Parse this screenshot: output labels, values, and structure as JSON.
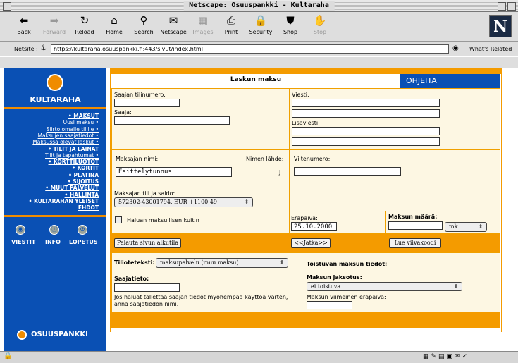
{
  "window": {
    "title": "Netscape: Osuuspankki - Kultaraha"
  },
  "toolbar": {
    "buttons": [
      {
        "label": "Back",
        "icon": "back-arrow-icon",
        "glyph": "⬅",
        "enabled": true
      },
      {
        "label": "Forward",
        "icon": "forward-arrow-icon",
        "glyph": "➡",
        "enabled": false
      },
      {
        "label": "Reload",
        "icon": "reload-icon",
        "glyph": "↻",
        "enabled": true
      },
      {
        "label": "Home",
        "icon": "home-icon",
        "glyph": "⌂",
        "enabled": true
      },
      {
        "label": "Search",
        "icon": "search-icon",
        "glyph": "⚲",
        "enabled": true
      },
      {
        "label": "Netscape",
        "icon": "netscape-icon",
        "glyph": "✉",
        "enabled": true
      },
      {
        "label": "Images",
        "icon": "images-icon",
        "glyph": "▦",
        "enabled": false
      },
      {
        "label": "Print",
        "icon": "print-icon",
        "glyph": "⎙",
        "enabled": true
      },
      {
        "label": "Security",
        "icon": "lock-icon",
        "glyph": "🔒",
        "enabled": true
      },
      {
        "label": "Shop",
        "icon": "shop-icon",
        "glyph": "⛊",
        "enabled": true
      },
      {
        "label": "Stop",
        "icon": "stop-icon",
        "glyph": "✋",
        "enabled": false
      }
    ],
    "logo_letter": "N"
  },
  "location": {
    "label": "Netsite :",
    "url": "https://kultaraha.osuuspankki.fi:443/sivut/index.html",
    "related": "What's Related"
  },
  "sidebar": {
    "brand": "KULTARAHA",
    "nav": [
      {
        "text": "• MAKSUT",
        "bold": true
      },
      {
        "text": "Uusi maksu •",
        "bold": false
      },
      {
        "text": "Siirto omalle tilille •",
        "bold": false
      },
      {
        "text": "Maksujen saajatiedot •",
        "bold": false
      },
      {
        "text": "Maksussa olevat laskut •",
        "bold": false
      },
      {
        "text": "• TILIT JA LAINAT",
        "bold": true
      },
      {
        "text": "Tilit ja tapahtumat •",
        "bold": false
      },
      {
        "text": "• KORTTILUOTOT",
        "bold": true
      },
      {
        "text": "• KORTIT",
        "bold": true
      },
      {
        "text": "• PLATINA",
        "bold": true
      },
      {
        "text": "• SIJOITUS",
        "bold": true
      },
      {
        "text": "• MUUT PALVELUT",
        "bold": true
      },
      {
        "text": "• HALLINTA",
        "bold": true
      },
      {
        "text": "• KULTARAHAN YLEISET",
        "bold": true
      },
      {
        "text": "EHDOT",
        "bold": true
      }
    ],
    "bottom_links": [
      {
        "label": "VIESTIT",
        "icon": "messages-icon"
      },
      {
        "label": "INFO",
        "icon": "info-icon"
      },
      {
        "label": "LOPETUS",
        "icon": "logout-icon"
      }
    ],
    "bank_name": "OSUUSPANKKI"
  },
  "form": {
    "title": "Laskun maksu",
    "help": "OHJEITA",
    "recipient_account_label": "Saajan tilinumero:",
    "recipient_label": "Saaja:",
    "message_label": "Viesti:",
    "additional_message_label": "Lisäviesti:",
    "payer_name_label": "Maksajan nimi:",
    "name_source_label": "Nimen lähde:",
    "payer_name_value": "Esittelytunnus",
    "name_source_value": "J",
    "reference_label": "Viitenumero:",
    "account_balance_label": "Maksajan tili ja saldo:",
    "account_balance_value": "572302-43001794, EUR +1100,49",
    "receipt_label": "Haluan maksullisen kuitin",
    "due_date_label": "Eräpäivä:",
    "due_date_value": "25.10.2000",
    "amount_label": "Maksun määrä:",
    "currency_value": "mk",
    "reset_button": "Palauta sivun alkutila",
    "continue_button": "<<Jatka>>",
    "barcode_button": "Lue viivakoodi",
    "statement_text_label": "Tilioteteksti:",
    "statement_text_value": "maksupalvelu (muu maksu)",
    "recipient_info_label": "Saajatieto:",
    "recipient_info_help": "Jos haluat tallettaa saajan tiedot myöhempää käyttöä varten, anna saajatiedon nimi.",
    "recurring_title": "Toistuvan maksun tiedot:",
    "recurrence_label": "Maksun jaksotus:",
    "recurrence_value": "ei toistuva",
    "last_due_label": "Maksun viimeinen eräpäivä:"
  },
  "colors": {
    "sidebar_blue": "#0a50b4",
    "accent_orange": "#f49b00",
    "panel_bg": "#fdf7e3"
  }
}
